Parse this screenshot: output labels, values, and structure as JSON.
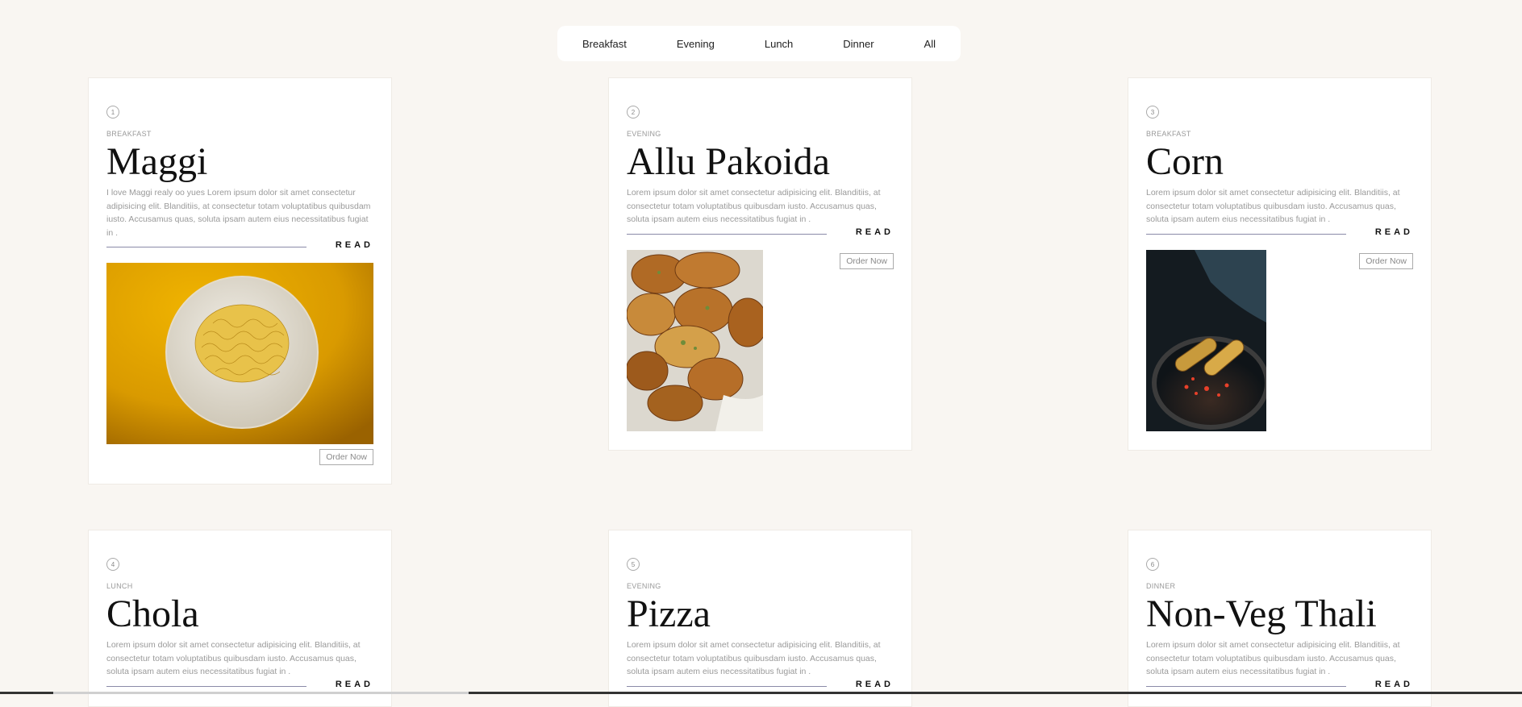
{
  "filters": [
    "Breakfast",
    "Evening",
    "Lunch",
    "Dinner",
    "All"
  ],
  "order_label": "Order Now",
  "read_label": "READ",
  "cards": [
    {
      "num": "1",
      "category": "BREAKFAST",
      "title": "Maggi",
      "desc": "I love Maggi realy oo yues Lorem ipsum dolor sit amet consectetur adipisicing elit. Blanditiis, at consectetur totam voluptatibus quibusdam iusto. Accusamus quas, soluta ipsam autem eius necessitatibus fugiat in ."
    },
    {
      "num": "2",
      "category": "EVENING",
      "title": "Allu Pakoida",
      "desc": "Lorem ipsum dolor sit amet consectetur adipisicing elit. Blanditiis, at consectetur totam voluptatibus quibusdam iusto. Accusamus quas, soluta ipsam autem eius necessitatibus fugiat in ."
    },
    {
      "num": "3",
      "category": "BREAKFAST",
      "title": "Corn",
      "desc": "Lorem ipsum dolor sit amet consectetur adipisicing elit. Blanditiis, at consectetur totam voluptatibus quibusdam iusto. Accusamus quas, soluta ipsam autem eius necessitatibus fugiat in ."
    },
    {
      "num": "4",
      "category": "LUNCH",
      "title": "Chola",
      "desc": "Lorem ipsum dolor sit amet consectetur adipisicing elit. Blanditiis, at consectetur totam voluptatibus quibusdam iusto. Accusamus quas, soluta ipsam autem eius necessitatibus fugiat in ."
    },
    {
      "num": "5",
      "category": "EVENING",
      "title": "Pizza",
      "desc": "Lorem ipsum dolor sit amet consectetur adipisicing elit. Blanditiis, at consectetur totam voluptatibus quibusdam iusto. Accusamus quas, soluta ipsam autem eius necessitatibus fugiat in ."
    },
    {
      "num": "6",
      "category": "DINNER",
      "title": "Non-Veg Thali",
      "desc": "Lorem ipsum dolor sit amet consectetur adipisicing elit. Blanditiis, at consectetur totam voluptatibus quibusdam iusto. Accusamus quas, soluta ipsam autem eius necessitatibus fugiat in ."
    }
  ]
}
